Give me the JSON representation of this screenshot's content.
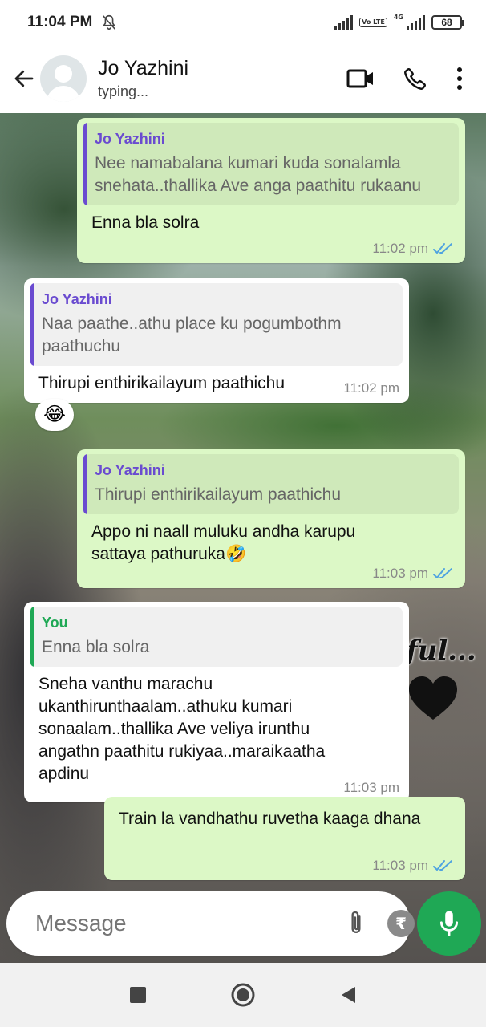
{
  "status_bar": {
    "time": "11:04 PM",
    "network": "4G",
    "volte": "Vo LTE",
    "battery": "68"
  },
  "header": {
    "contact_name": "Jo Yazhini",
    "contact_status": "typing..."
  },
  "chat": {
    "background_text": "ful...",
    "messages": [
      {
        "direction": "outgoing",
        "quote": {
          "author": "Jo Yazhini",
          "text": "Nee namabalana kumari kuda sonalamla snehata..thallika Ave anga paathitu rukaanu"
        },
        "text": "Enna bla solra",
        "time": "11:02 pm",
        "read": true
      },
      {
        "direction": "incoming",
        "quote": {
          "author": "Jo Yazhini",
          "text": "Naa paathe..athu place ku pogumbothm paathuchu"
        },
        "text": "Thirupi enthirikailayum paathichu",
        "time": "11:02 pm",
        "reaction": "😂"
      },
      {
        "direction": "outgoing",
        "quote": {
          "author": "Jo Yazhini",
          "text": "Thirupi enthirikailayum paathichu"
        },
        "text": "Appo ni naall muluku andha karupu sattaya pathuruka🤣",
        "time": "11:03 pm",
        "read": true
      },
      {
        "direction": "incoming",
        "quote": {
          "author": "You",
          "text": "Enna bla solra"
        },
        "text": "Sneha vanthu marachu ukanthirunthaalam..athuku kumari sonaalam..thallika Ave veliya irunthu angathn paathitu rukiyaa..maraikaatha apdinu",
        "time": "11:03 pm"
      },
      {
        "direction": "outgoing",
        "text": "Train la vandhathu ruvetha kaaga dhana",
        "time": "11:03 pm",
        "read": true
      }
    ]
  },
  "composer": {
    "placeholder": "Message",
    "rupee_symbol": "₹"
  },
  "colors": {
    "outgoing_bubble": "#dcf8c6",
    "incoming_bubble": "#ffffff",
    "accent_green": "#1fa855",
    "quote_author_purple": "#6a4bd0",
    "read_ticks": "#4fa3e0"
  }
}
